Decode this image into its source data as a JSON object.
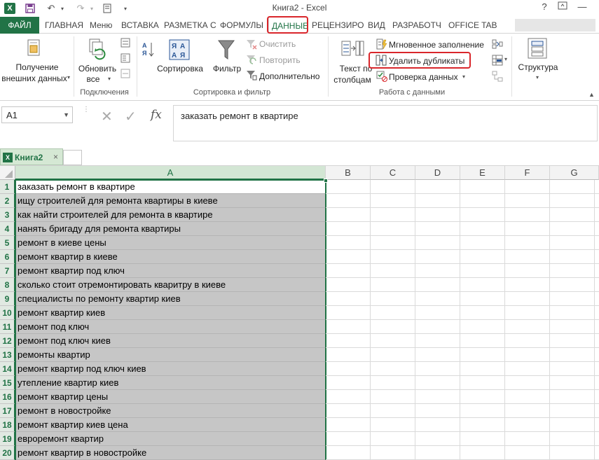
{
  "window": {
    "title": "Книга2 - Excel",
    "help_glyph": "?",
    "minimize_glyph": "—"
  },
  "ribbon_tabs": [
    {
      "label": "ФАЙЛ"
    },
    {
      "label": "ГЛАВНАЯ"
    },
    {
      "label": "Меню"
    },
    {
      "label": "ВСТАВКА"
    },
    {
      "label": "РАЗМЕТКА С"
    },
    {
      "label": "ФОРМУЛЫ"
    },
    {
      "label": "ДАННЫЕ"
    },
    {
      "label": "РЕЦЕНЗИРО"
    },
    {
      "label": "ВИД"
    },
    {
      "label": "РАЗРАБОТЧ"
    },
    {
      "label": "OFFICE TAB"
    }
  ],
  "ribbon": {
    "get_external_line1": "Получение",
    "get_external_line2": "внешних данных",
    "refresh_line1": "Обновить",
    "refresh_line2": "все",
    "connections_group": "Подключения",
    "sort": "Сортировка",
    "filter": "Фильтр",
    "clear": "Очистить",
    "reapply": "Повторить",
    "advanced": "Дополнительно",
    "sort_filter_group": "Сортировка и фильтр",
    "text_to_columns_line1": "Текст по",
    "text_to_columns_line2": "столбцам",
    "flash_fill": "Мгновенное заполнение",
    "remove_duplicates": "Удалить дубликаты",
    "data_validation": "Проверка данных",
    "data_tools_group": "Работа с данными",
    "outline": "Структура"
  },
  "formula_bar": {
    "name_box": "A1",
    "fx": "fx",
    "content": "заказать ремонт в квартире"
  },
  "workbook_tab": {
    "name": "Книга2",
    "close": "×"
  },
  "columns": [
    "A",
    "B",
    "C",
    "D",
    "E",
    "F",
    "G"
  ],
  "rows": [
    {
      "n": "1",
      "a": "заказать ремонт в квартире"
    },
    {
      "n": "2",
      "a": "ищу строителей для ремонта квартиры в киеве"
    },
    {
      "n": "3",
      "a": "как найти строителей для ремонта в квартире"
    },
    {
      "n": "4",
      "a": "нанять бригаду для ремонта квартиры"
    },
    {
      "n": "5",
      "a": "ремонт в киеве цены"
    },
    {
      "n": "6",
      "a": "ремонт квартир в киеве"
    },
    {
      "n": "7",
      "a": "ремонт квартир под ключ"
    },
    {
      "n": "8",
      "a": "сколько стоит отремонтировать кваритру в киеве"
    },
    {
      "n": "9",
      "a": "специалисты по ремонту квартир киев"
    },
    {
      "n": "10",
      "a": "ремонт квартир киев"
    },
    {
      "n": "11",
      "a": "ремонт под ключ"
    },
    {
      "n": "12",
      "a": "ремонт под ключ киев"
    },
    {
      "n": "13",
      "a": "ремонты квартир"
    },
    {
      "n": "14",
      "a": "ремонт квартир под ключ киев"
    },
    {
      "n": "15",
      "a": "утепление квартир киев"
    },
    {
      "n": "16",
      "a": "ремонт квартир цены"
    },
    {
      "n": "17",
      "a": "ремонт в новостройке"
    },
    {
      "n": "18",
      "a": "ремонт квартир киев цена"
    },
    {
      "n": "19",
      "a": "евроремонт квартир"
    },
    {
      "n": "20",
      "a": "ремонт квартир в новостройке"
    }
  ],
  "colors": {
    "excel_green": "#217346",
    "highlight_red": "#d9262b",
    "selection_fill": "#c6c6c6"
  }
}
